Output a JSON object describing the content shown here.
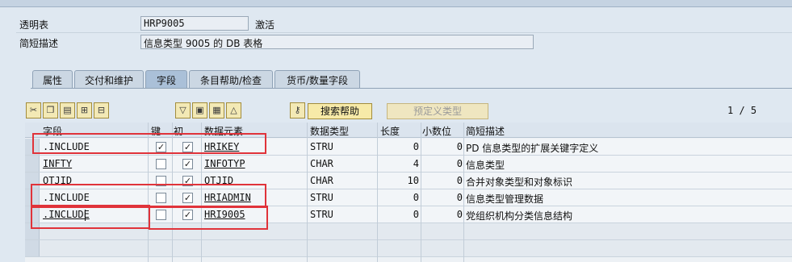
{
  "header": {
    "table_label": "透明表",
    "table_name": "HRP9005",
    "status": "激活",
    "desc_label": "简短描述",
    "desc_value": "信息类型 9005 的 DB 表格"
  },
  "tabs": [
    {
      "label": "属性"
    },
    {
      "label": "交付和维护"
    },
    {
      "label": "字段",
      "active": true
    },
    {
      "label": "条目帮助/检查"
    },
    {
      "label": "货币/数量字段"
    }
  ],
  "toolbar": {
    "search_help": "搜索帮助",
    "predefined_type": "预定义类型",
    "pager": "1 / 5"
  },
  "columns": [
    "字段",
    "键",
    "初",
    "数据元素",
    "数据类型",
    "长度",
    "小数位",
    "简短描述"
  ],
  "rows": [
    {
      "field": ".INCLUDE",
      "key": true,
      "init": true,
      "element": "HRIKEY",
      "type": "STRU",
      "length": "0",
      "decimals": "0",
      "desc": "PD 信息类型的扩展关键字定义"
    },
    {
      "field": "INFTY",
      "key": false,
      "init": true,
      "element": "INFOTYP",
      "type": "CHAR",
      "length": "4",
      "decimals": "0",
      "desc": "信息类型"
    },
    {
      "field": "OTJID",
      "key": false,
      "init": true,
      "element": "OTJID",
      "type": "CHAR",
      "length": "10",
      "decimals": "0",
      "desc": "合并对象类型和对象标识"
    },
    {
      "field": ".INCLUDE",
      "key": false,
      "init": true,
      "element": "HRIADMIN",
      "type": "STRU",
      "length": "0",
      "decimals": "0",
      "desc": "信息类型管理数据"
    },
    {
      "field": ".INCLUDE",
      "key": false,
      "init": true,
      "element": "HRI9005",
      "type": "STRU",
      "length": "0",
      "decimals": "0",
      "desc": "党组织机构分类信息结构"
    }
  ],
  "colors": {
    "highlight": "#e0333a",
    "button": "#f7eaa8"
  }
}
